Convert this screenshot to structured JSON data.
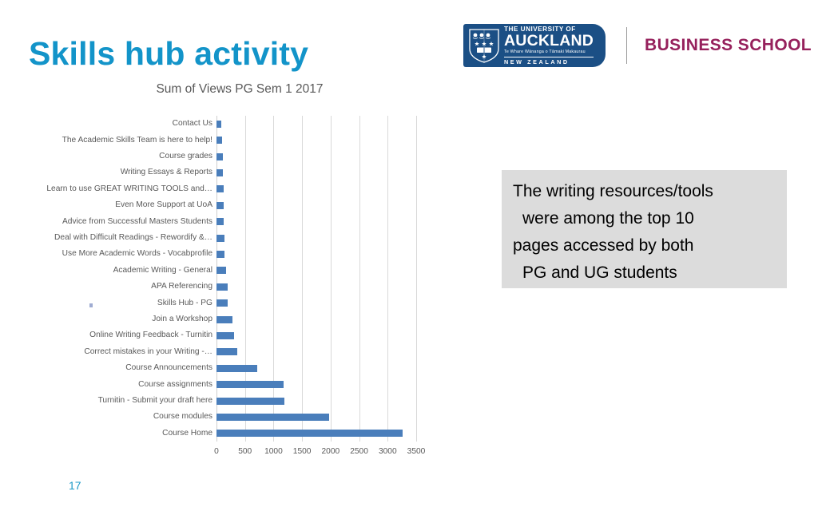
{
  "slide": {
    "title": "Skills hub activity",
    "page_number": "17"
  },
  "logo": {
    "crest_icon": "university-crest-icon",
    "line1": "THE UNIVERSITY OF",
    "line2": "AUCKLAND",
    "line3": "Te Whare Wānanga o Tāmaki Makaurau",
    "line4": "NEW ZEALAND",
    "business_school": "BUSINESS SCHOOL",
    "crest_color": "#1B4F85",
    "business_school_color": "#96215C"
  },
  "callout": {
    "lines": [
      "The writing resources/tools",
      "were among the top 10",
      "pages accessed by both",
      "PG and UG students"
    ],
    "background": "#DCDCDC"
  },
  "chart_data": {
    "type": "bar",
    "orientation": "horizontal",
    "title": "Sum of Views PG Sem 1 2017",
    "xlabel": "",
    "ylabel": "",
    "xlim": [
      0,
      3500
    ],
    "xticks": [
      0,
      500,
      1000,
      1500,
      2000,
      2500,
      3000,
      3500
    ],
    "xtick_labels": [
      "0",
      "500",
      "1000",
      "1500",
      "2000",
      "2500",
      "3000",
      "3500"
    ],
    "grid": "vertical",
    "legend": "none",
    "bar_color": "#4A7EBB",
    "categories": [
      "Contact Us",
      "The Academic Skills Team is here to help!",
      "Course grades",
      "Writing Essays & Reports",
      "Learn to use GREAT WRITING TOOLS and…",
      "Even More Support at UoA",
      "Advice from Successful Masters Students",
      "Deal with Difficult Readings - Rewordify &…",
      "Use More Academic Words - Vocabprofile",
      "Academic Writing - General",
      "APA Referencing",
      "Skills Hub - PG",
      "Join a Workshop",
      "Online Writing Feedback - Turnitin",
      "Correct mistakes in your Writing -…",
      "Course Announcements",
      "Course assignments",
      "Turnitin - Submit your draft here",
      "Course modules",
      "Course Home"
    ],
    "values": [
      80,
      95,
      105,
      110,
      120,
      125,
      125,
      145,
      145,
      170,
      195,
      190,
      285,
      305,
      360,
      720,
      1180,
      1190,
      1980,
      3260
    ]
  }
}
